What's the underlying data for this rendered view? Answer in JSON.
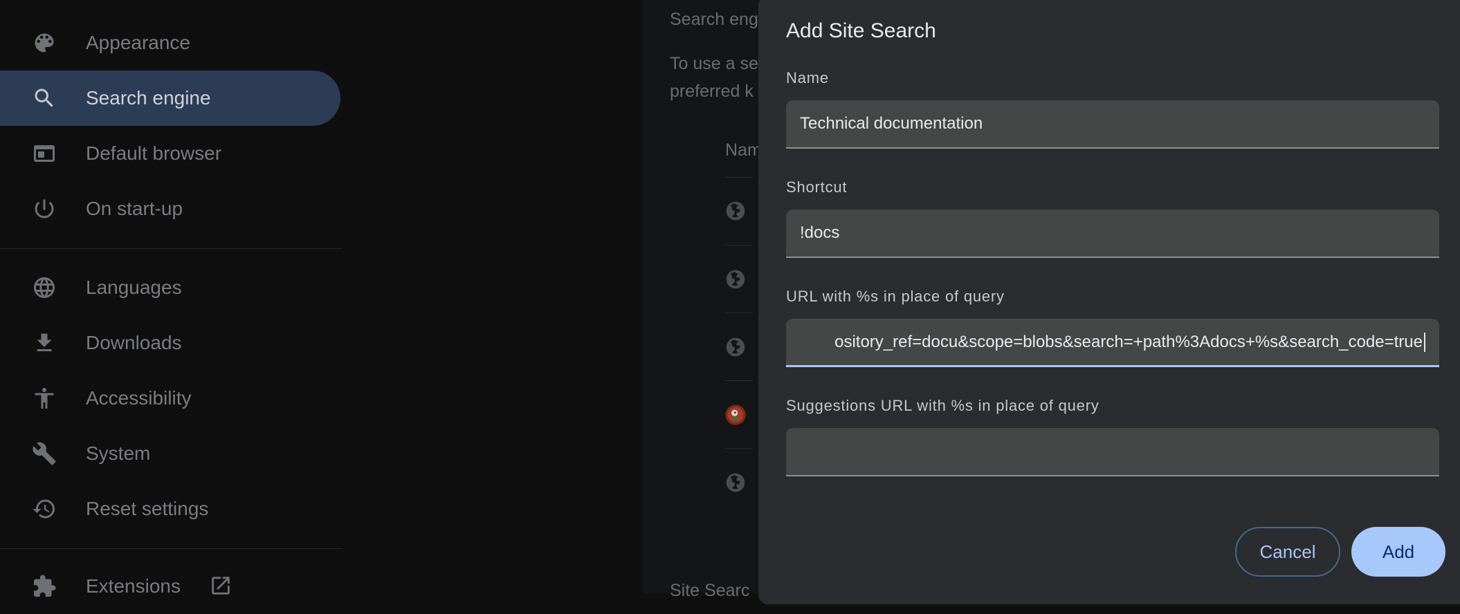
{
  "sidebar": {
    "items": [
      {
        "label": "Appearance",
        "icon": "palette-icon"
      },
      {
        "label": "Search engine",
        "icon": "search-icon",
        "active": true
      },
      {
        "label": "Default browser",
        "icon": "browser-window-icon"
      },
      {
        "label": "On start-up",
        "icon": "power-icon"
      },
      {
        "label": "Languages",
        "icon": "globe-icon"
      },
      {
        "label": "Downloads",
        "icon": "download-icon"
      },
      {
        "label": "Accessibility",
        "icon": "accessibility-icon"
      },
      {
        "label": "System",
        "icon": "wrench-icon"
      },
      {
        "label": "Reset settings",
        "icon": "history-icon"
      },
      {
        "label": "Extensions",
        "icon": "puzzle-icon"
      }
    ]
  },
  "main": {
    "section_title": "Search eng",
    "description_line1": "To use a se",
    "description_line2": "preferred k",
    "column_header": "Nam",
    "bottom_section_title": "Site Searc"
  },
  "dialog": {
    "title": "Add Site Search",
    "name_label": "Name",
    "name_value": "Technical documentation",
    "shortcut_label": "Shortcut",
    "shortcut_value": "!docs",
    "url_label": "URL with %s in place of query",
    "url_value_visible": "ository_ref=docu&scope=blobs&search=+path%3Adocs+%s&search_code=true",
    "suggestions_label": "Suggestions URL with %s in place of query",
    "suggestions_value": "",
    "cancel_label": "Cancel",
    "add_label": "Add"
  },
  "colors": {
    "accent": "#a8c7fa",
    "active_nav_bg": "#2c3c55",
    "dialog_bg": "#2b2c2f",
    "field_bg": "#454746"
  }
}
